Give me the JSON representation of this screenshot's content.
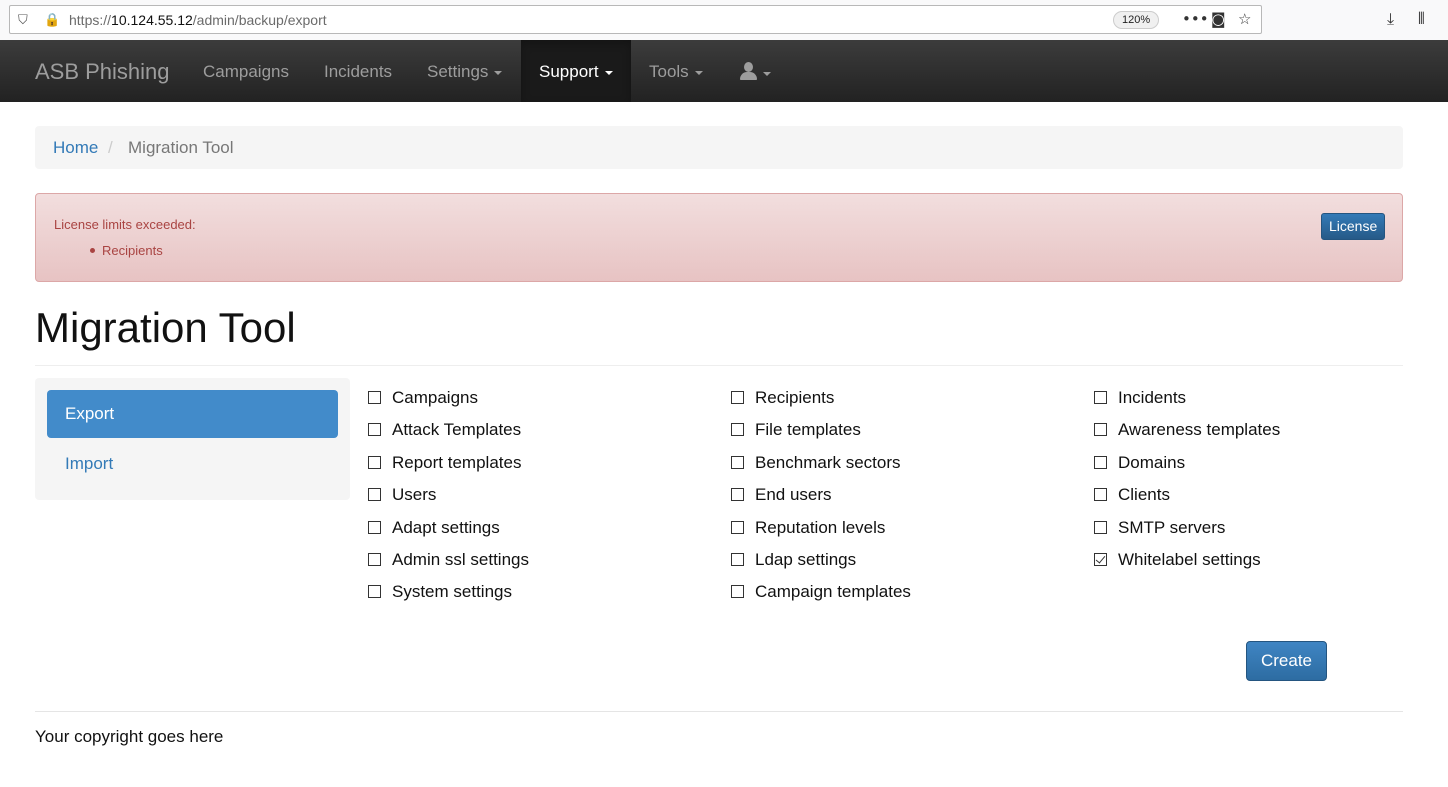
{
  "browser": {
    "url_prefix": "https://",
    "url_host": "10.124.55.12",
    "url_path": "/admin/backup/export",
    "zoom": "120%",
    "icons": [
      "shield-icon",
      "lock-warning-icon",
      "more-icon",
      "pocket-icon",
      "bookmark-star-icon",
      "download-icon",
      "library-icon"
    ]
  },
  "navbar": {
    "brand": "ASB Phishing",
    "items": [
      {
        "label": "Campaigns"
      },
      {
        "label": "Incidents"
      },
      {
        "label": "Settings"
      },
      {
        "label": "Support"
      },
      {
        "label": "Tools"
      }
    ],
    "active": "Support",
    "user_icon": "user-icon"
  },
  "breadcrumb": {
    "home": "Home",
    "separator": "/",
    "current": "Migration Tool"
  },
  "alert": {
    "title": "License limits exceeded:",
    "items": [
      "Recipients"
    ],
    "button": "License"
  },
  "page": {
    "title": "Migration Tool"
  },
  "tabs": {
    "export": "Export",
    "import": "Import",
    "active": "Export"
  },
  "options": {
    "col1": [
      {
        "label": "Campaigns",
        "checked": false
      },
      {
        "label": "Attack Templates",
        "checked": false
      },
      {
        "label": "Report templates",
        "checked": false
      },
      {
        "label": "Users",
        "checked": false
      },
      {
        "label": "Adapt settings",
        "checked": false
      },
      {
        "label": "Admin ssl settings",
        "checked": false
      },
      {
        "label": "System settings",
        "checked": false
      }
    ],
    "col2": [
      {
        "label": "Recipients",
        "checked": false
      },
      {
        "label": "File templates",
        "checked": false
      },
      {
        "label": "Benchmark sectors",
        "checked": false
      },
      {
        "label": "End users",
        "checked": false
      },
      {
        "label": "Reputation levels",
        "checked": false
      },
      {
        "label": "Ldap settings",
        "checked": false
      },
      {
        "label": "Campaign templates",
        "checked": false
      }
    ],
    "col3": [
      {
        "label": "Incidents",
        "checked": false
      },
      {
        "label": "Awareness templates",
        "checked": false
      },
      {
        "label": "Domains",
        "checked": false
      },
      {
        "label": "Clients",
        "checked": false
      },
      {
        "label": "SMTP servers",
        "checked": false
      },
      {
        "label": "Whitelabel settings",
        "checked": true
      }
    ]
  },
  "actions": {
    "create": "Create"
  },
  "footer": {
    "text": "Your copyright goes here"
  },
  "colors": {
    "navbar": "#222222",
    "link": "#337ab7",
    "alert_text": "#a94442",
    "primary": "#428bca"
  }
}
